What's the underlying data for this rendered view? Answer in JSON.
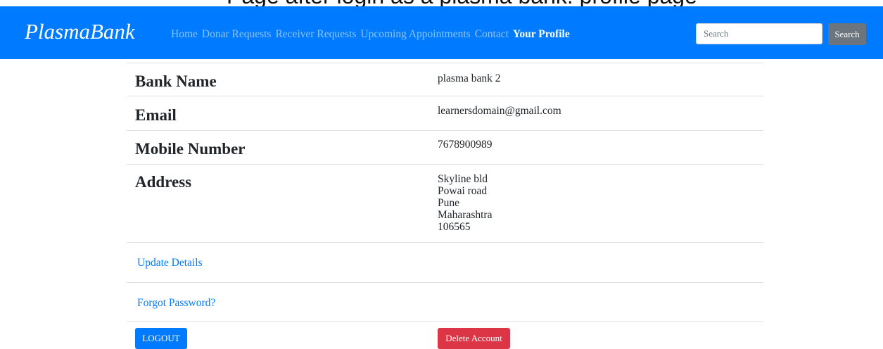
{
  "top_caption": "Page after login as a plasma bank: profile page",
  "navbar": {
    "brand": "PlasmaBank",
    "links": [
      {
        "label": "Home"
      },
      {
        "label": "Donar Requests"
      },
      {
        "label": "Receiver Requests"
      },
      {
        "label": "Upcoming Appointments"
      },
      {
        "label": "Contact"
      },
      {
        "label": "Your Profile",
        "active": true
      }
    ],
    "search": {
      "placeholder": "Search",
      "value": "",
      "button_label": "Search"
    },
    "bg_color": "#007bff"
  },
  "profile": {
    "bank_name": {
      "label": "Bank Name",
      "value": "plasma bank 2"
    },
    "email": {
      "label": "Email",
      "value": "learnersdomain@gmail.com"
    },
    "mobile": {
      "label": "Mobile Number",
      "value": "7678900989"
    },
    "address": {
      "label": "Address",
      "lines": [
        "Skyline bld",
        "Powai road",
        "Pune",
        "Maharashtra",
        "106565"
      ]
    }
  },
  "actions": {
    "update_details": "Update Details",
    "forgot_password": "Forgot Password?",
    "logout": "LOGOUT",
    "delete_account": "Delete Account"
  },
  "colors": {
    "primary": "#007bff",
    "danger": "#dc3545",
    "secondary": "#6c757d"
  }
}
